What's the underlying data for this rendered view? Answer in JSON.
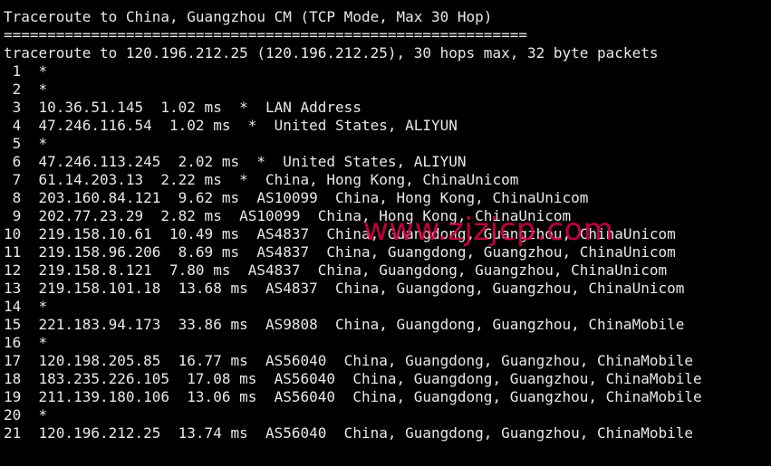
{
  "terminal": {
    "header": "Traceroute to China, Guangzhou CM (TCP Mode, Max 30 Hop)",
    "separator": "============================================================",
    "command_line": "traceroute to 120.196.212.25 (120.196.212.25), 30 hops max, 32 byte packets",
    "hops": [
      " 1  *",
      " 2  *",
      " 3  10.36.51.145  1.02 ms  *  LAN Address",
      " 4  47.246.116.54  1.02 ms  *  United States, ALIYUN",
      " 5  *",
      " 6  47.246.113.245  2.02 ms  *  United States, ALIYUN",
      " 7  61.14.203.13  2.22 ms  *  China, Hong Kong, ChinaUnicom",
      " 8  203.160.84.121  9.62 ms  AS10099  China, Hong Kong, ChinaUnicom",
      " 9  202.77.23.29  2.82 ms  AS10099  China, Hong Kong, ChinaUnicom",
      "10  219.158.10.61  10.49 ms  AS4837  China, Guangdong, Guangzhou, ChinaUnicom",
      "11  219.158.96.206  8.69 ms  AS4837  China, Guangdong, Guangzhou, ChinaUnicom",
      "12  219.158.8.121  7.80 ms  AS4837  China, Guangdong, Guangzhou, ChinaUnicom",
      "13  219.158.101.18  13.68 ms  AS4837  China, Guangdong, Guangzhou, ChinaUnicom",
      "14  *",
      "15  221.183.94.173  33.86 ms  AS9808  China, Guangdong, Guangzhou, ChinaMobile",
      "16  *",
      "17  120.198.205.85  16.77 ms  AS56040  China, Guangdong, Guangzhou, ChinaMobile",
      "18  183.235.226.105  17.08 ms  AS56040  China, Guangdong, Guangzhou, ChinaMobile",
      "19  211.139.180.106  13.06 ms  AS56040  China, Guangdong, Guangzhou, ChinaMobile",
      "20  *",
      "21  120.196.212.25  13.74 ms  AS56040  China, Guangdong, Guangzhou, ChinaMobile"
    ]
  },
  "watermark": {
    "text": "www.zjzjcp.com"
  },
  "colors": {
    "background": "#000000",
    "text": "#e8e8e8",
    "watermark": "#e0004a"
  }
}
